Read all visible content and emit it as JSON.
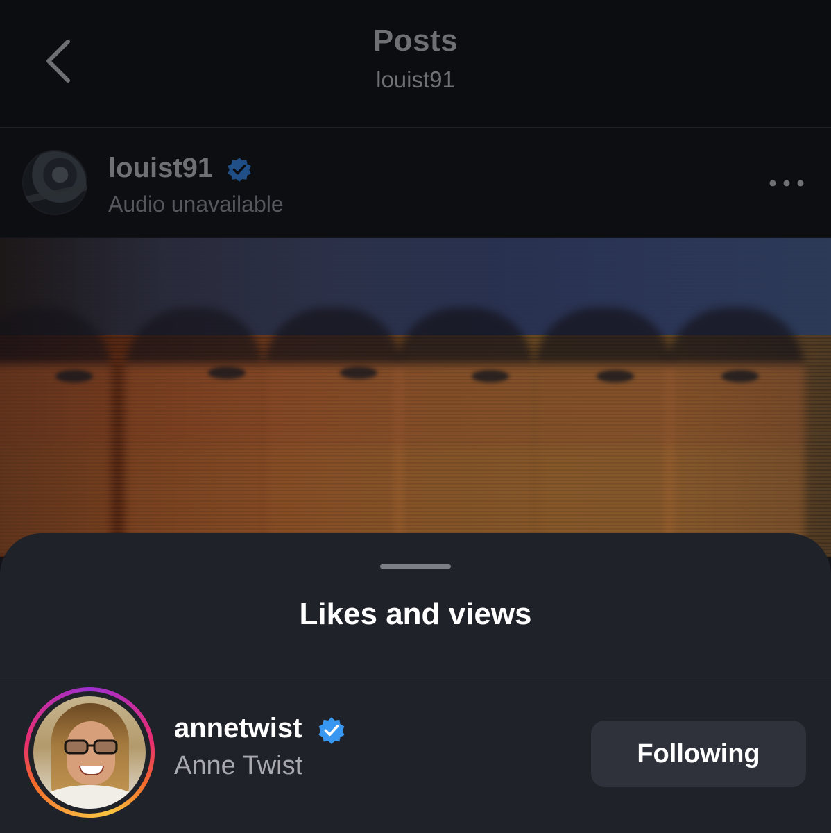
{
  "header": {
    "title": "Posts",
    "subtitle": "louist91",
    "back_icon": "chevron-left-icon"
  },
  "post": {
    "author": {
      "username": "louist91",
      "verified": true,
      "audio_status": "Audio unavailable"
    },
    "more_icon": "more-horizontal-icon"
  },
  "sheet": {
    "title": "Likes and views",
    "likers": [
      {
        "username": "annetwist",
        "full_name": "Anne Twist",
        "verified": true,
        "has_story_ring": true,
        "button_label": "Following"
      }
    ]
  },
  "colors": {
    "verified_badge": "#3897f0",
    "sheet_background": "#202229",
    "following_button": "#2f323b",
    "dim_text": "#6e7074",
    "secondary_text": "#a8aab0"
  }
}
